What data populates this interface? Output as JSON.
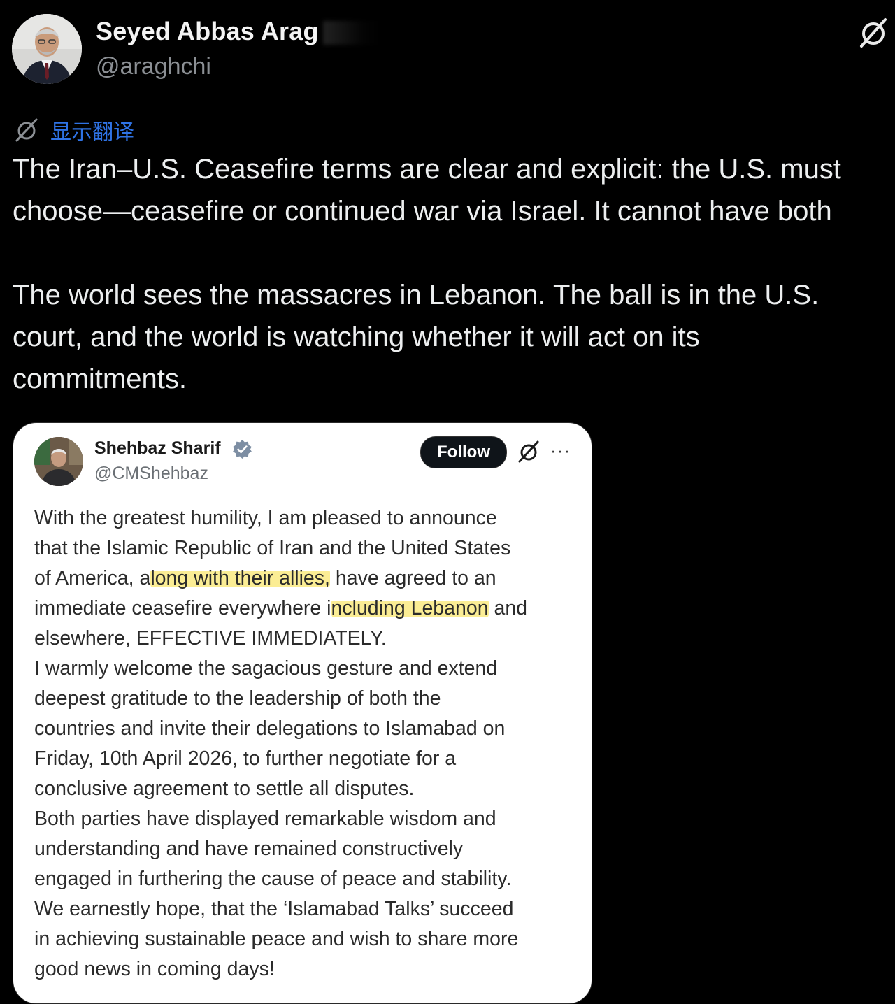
{
  "tweet": {
    "author_name": "Seyed Abbas Arag",
    "author_handle": "@araghchi",
    "translate_label": "显示翻译",
    "text_lines": [
      "The Iran–U.S. Ceasefire terms are clear and explicit: the U.S. must",
      "choose—ceasefire or continued war via Israel. It cannot have both",
      "",
      "The world sees the massacres in Lebanon. The ball is in the U.S.",
      "court, and the world is watching whether it will act on its",
      "commitments."
    ]
  },
  "quoted": {
    "author_name": "Shehbaz Sharif",
    "author_handle": "@CMShehbaz",
    "follow_label": "Follow",
    "more_label": "···",
    "lines": {
      "l1": "With the greatest humility, I am pleased to announce",
      "l2": "that the Islamic Republic of Iran and the United States",
      "l3a": "of America, a",
      "l3b": "long with their allies,",
      "l3c": " have agreed to an",
      "l4a": "immediate ceasefire everywhere i",
      "l4b": "ncluding Lebanon",
      "l4c": " and",
      "l5": "elsewhere, EFFECTIVE IMMEDIATELY.",
      "l6": "I warmly welcome the sagacious gesture and extend",
      "l7": "deepest gratitude to the leadership of both the",
      "l8": "countries and invite their delegations to Islamabad on",
      "l9": "Friday, 10th April 2026, to further negotiate for a",
      "l10": "conclusive agreement to settle all disputes.",
      "l11": "Both parties have displayed remarkable wisdom and",
      "l12": "understanding and have remained constructively",
      "l13": "engaged in furthering the cause of peace and stability.",
      "l14": "We earnestly hope, that the ‘Islamabad Talks’ succeed",
      "l15": "in achieving sustainable peace and wish to share more",
      "l16": "good news in coming days!"
    }
  },
  "colors": {
    "background": "#000000",
    "link": "#2f73e5",
    "verified": "#7d8ea3",
    "highlight": "#faea82"
  },
  "icons": [
    "grok-icon",
    "verified-badge-icon",
    "more-icon"
  ]
}
